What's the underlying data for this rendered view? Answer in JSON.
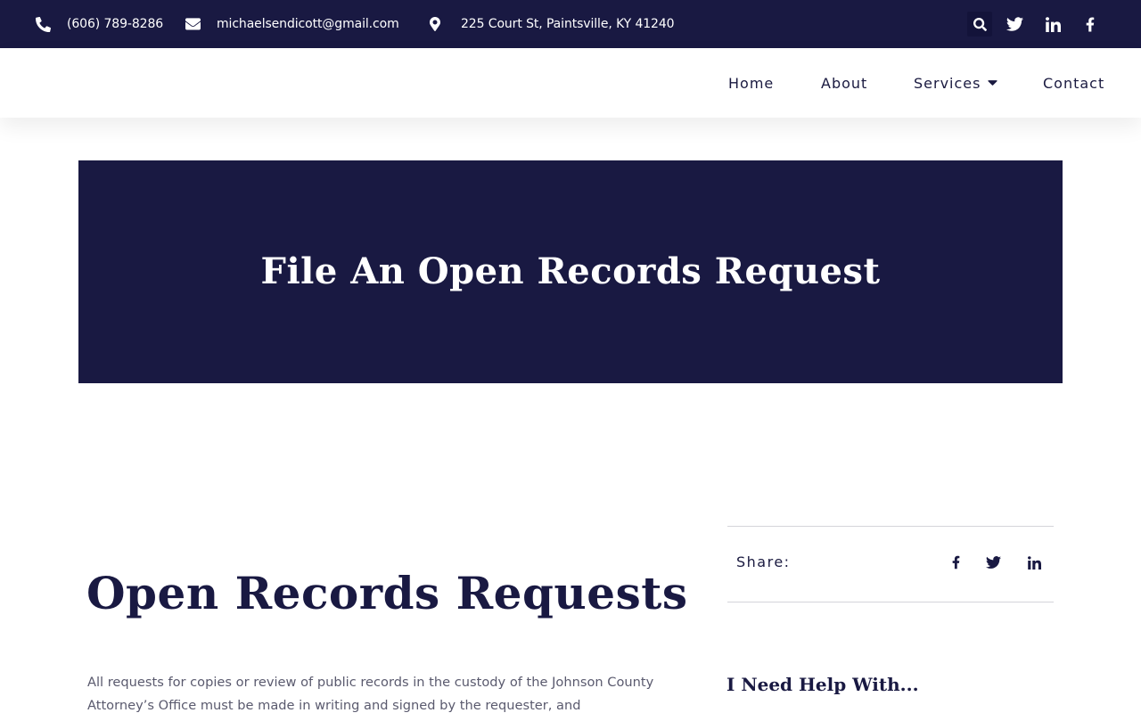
{
  "topbar": {
    "phone": "(606) 789-8286",
    "email": "michaelsendicott@gmail.com",
    "address": "225 Court St, Paintsville, KY 41240",
    "icons": [
      "phone-icon",
      "envelope-icon",
      "map-marker-icon",
      "search-icon",
      "twitter-icon",
      "linkedin-icon",
      "facebook-icon"
    ]
  },
  "nav": {
    "home": "Home",
    "about": "About",
    "services": "Services",
    "contact": "Contact"
  },
  "hero": {
    "title": "File An Open Records Request"
  },
  "main": {
    "title": "Open Records Requests",
    "paragraph": "All requests for copies or review of public records in the custody of the Johnson County Attorney’s Office must be made in writing and signed by the requester, and"
  },
  "sidebar": {
    "share_label": "Share:",
    "share_icons": [
      "facebook-icon",
      "twitter-icon",
      "linkedin-icon"
    ],
    "help_title": "I Need Help With..."
  },
  "colors": {
    "navy": "#191942",
    "white": "#ffffff",
    "body_text": "#5a5a6e",
    "divider": "#d4d4da"
  }
}
